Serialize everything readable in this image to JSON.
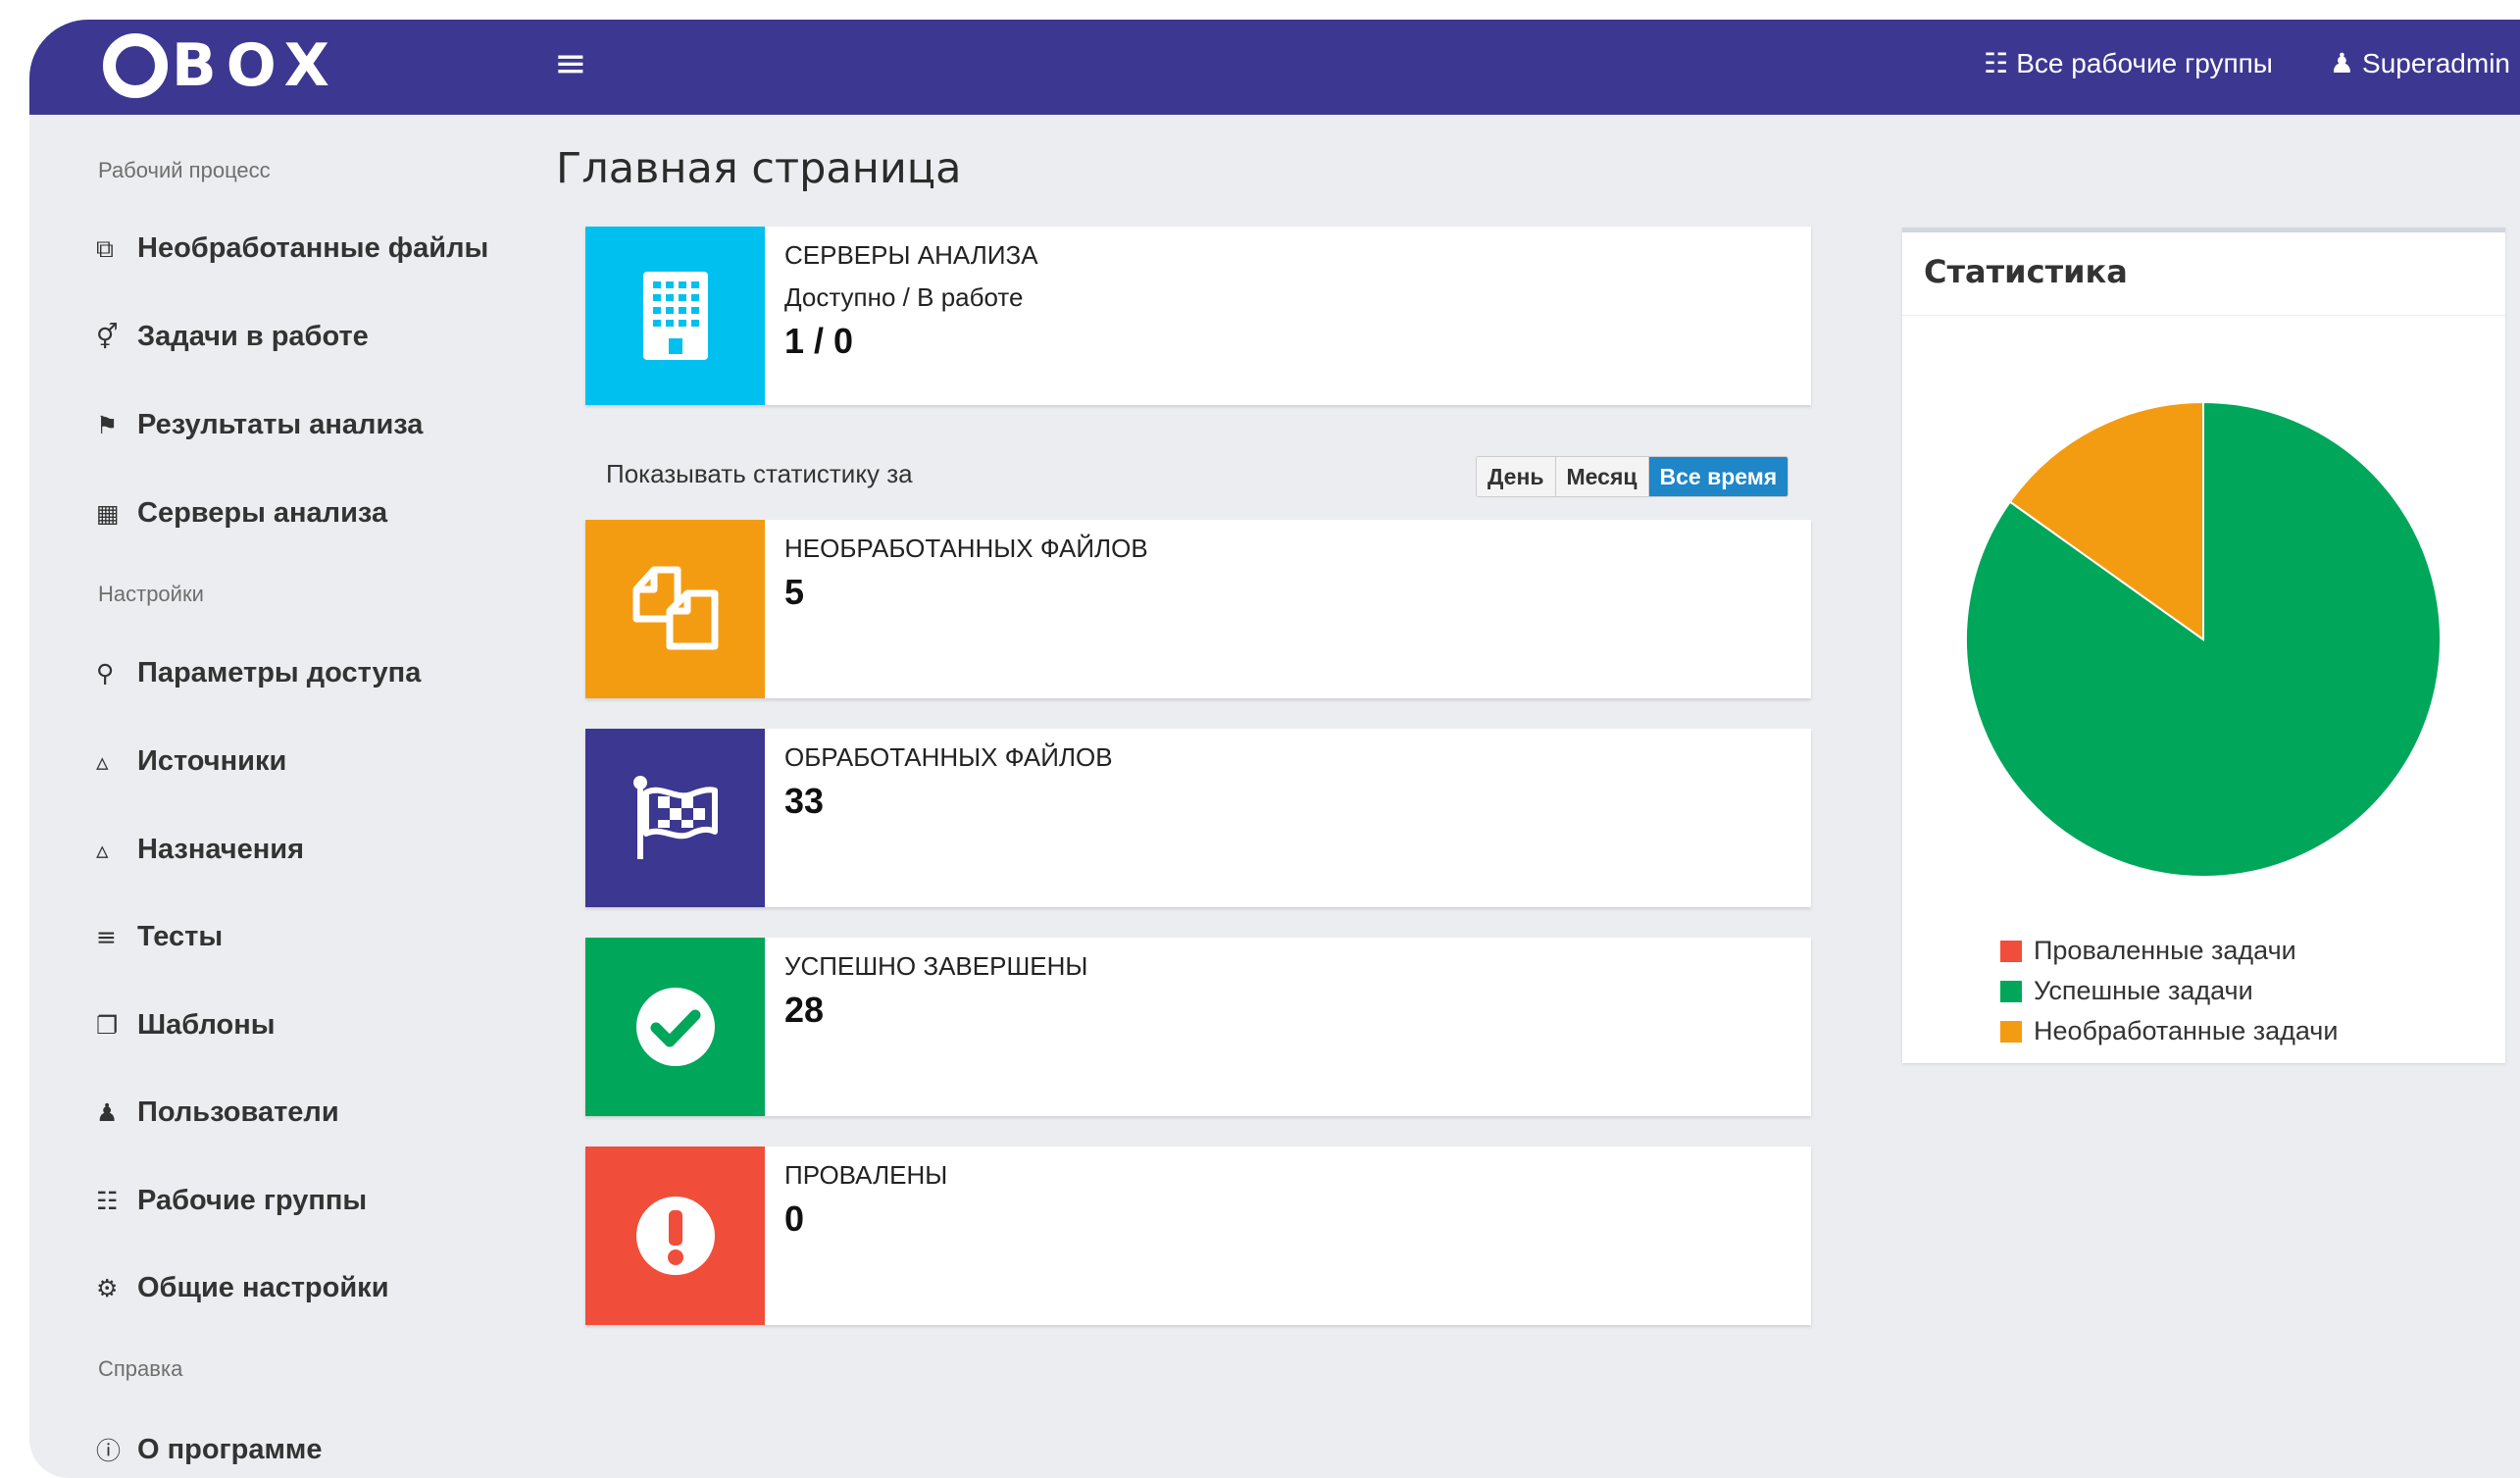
{
  "app": {
    "logo_text": "BOX"
  },
  "topbar": {
    "workgroups_label": "Все рабочие группы",
    "user_label": "Superadmin"
  },
  "sidebar": {
    "sections": [
      {
        "title": "Рабочий процесс"
      },
      {
        "title": "Настройки"
      },
      {
        "title": "Справка"
      }
    ],
    "items": [
      {
        "label": "Необработанные файлы",
        "icon": "files-icon"
      },
      {
        "label": "Задачи в работе",
        "icon": "stethoscope-icon"
      },
      {
        "label": "Результаты анализа",
        "icon": "flag-checkered-icon"
      },
      {
        "label": "Серверы анализа",
        "icon": "building-icon"
      },
      {
        "label": "Параметры доступа",
        "icon": "key-icon"
      },
      {
        "label": "Источники",
        "icon": "folder-open-icon"
      },
      {
        "label": "Назначения",
        "icon": "folder-open-icon"
      },
      {
        "label": "Тесты",
        "icon": "sliders-icon"
      },
      {
        "label": "Шаблоны",
        "icon": "clone-icon"
      },
      {
        "label": "Пользователи",
        "icon": "users-icon"
      },
      {
        "label": "Рабочие группы",
        "icon": "sitemap-icon"
      },
      {
        "label": "Общие настройки",
        "icon": "cogs-icon"
      },
      {
        "label": "О программе",
        "icon": "info-circle-icon"
      }
    ]
  },
  "main": {
    "page_title": "Главная страница",
    "servers_card": {
      "title": "СЕРВЕРЫ АНАЛИЗА",
      "subtitle": "Доступно / В работе",
      "value": "1 / 0",
      "color": "#00c0ef"
    },
    "period": {
      "label": "Показывать статистику за",
      "buttons": [
        "День",
        "Месяц",
        "Все время"
      ],
      "active": "Все время"
    },
    "cards": [
      {
        "title": "НЕОБРАБОТАННЫХ ФАЙЛОВ",
        "value": "5",
        "color": "#f39c12",
        "icon": "files-icon"
      },
      {
        "title": "ОБРАБОТАННЫХ ФАЙЛОВ",
        "value": "33",
        "color": "#3c3791",
        "icon": "flag-checkered-icon"
      },
      {
        "title": "УСПЕШНО ЗАВЕРШЕНЫ",
        "value": "28",
        "color": "#00a65a",
        "icon": "check-circle-icon"
      },
      {
        "title": "ПРОВАЛЕНЫ",
        "value": "0",
        "color": "#f04e3a",
        "icon": "exclamation-circle-icon"
      }
    ]
  },
  "stats_panel": {
    "title": "Статистика",
    "chart_data": {
      "type": "pie",
      "series": [
        {
          "name": "Проваленные задачи",
          "value": 0,
          "color": "#f04e3a"
        },
        {
          "name": "Успешные задачи",
          "value": 28,
          "color": "#00a65a"
        },
        {
          "name": "Необработанные задачи",
          "value": 5,
          "color": "#f39c12"
        }
      ],
      "legend_position": "bottom"
    }
  }
}
